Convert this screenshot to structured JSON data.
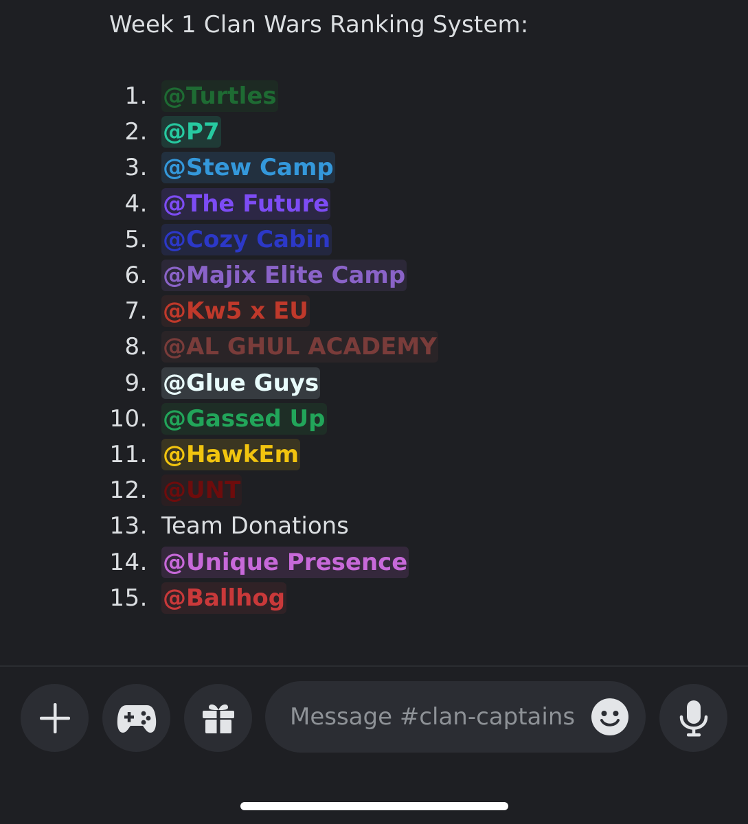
{
  "message": {
    "title": "Week 1 Clan Wars Ranking System:",
    "rankings": [
      {
        "num": "1.",
        "label": "@Turtles",
        "color": "#1e6b33",
        "bg": "#1d2a23",
        "mention": true
      },
      {
        "num": "2.",
        "label": "@P7",
        "color": "#27c9a0",
        "bg": "#1f3a36",
        "mention": true
      },
      {
        "num": "3.",
        "label": "@Stew Camp",
        "color": "#3498db",
        "bg": "#22303f",
        "mention": true
      },
      {
        "num": "4.",
        "label": "@The Future",
        "color": "#7d4cf4",
        "bg": "#2c2745",
        "mention": true
      },
      {
        "num": "5.",
        "label": "@Cozy Cabin",
        "color": "#2c38c8",
        "bg": "#232740",
        "mention": true
      },
      {
        "num": "6.",
        "label": "@Majix Elite Camp",
        "color": "#8a63c8",
        "bg": "#2c2838",
        "mention": true
      },
      {
        "num": "7.",
        "label": "@Kw5 x EU",
        "color": "#c0392b",
        "bg": "#2e2325",
        "mention": true
      },
      {
        "num": "8.",
        "label": "@AL GHUL ACADEMY",
        "color": "#7a3c3a",
        "bg": "#2a2427",
        "mention": true
      },
      {
        "num": "9.",
        "label": "@Glue Guys",
        "color": "#e8fbfb",
        "bg": "#363b40",
        "mention": true
      },
      {
        "num": "10.",
        "label": "@Gassed Up",
        "color": "#22a55a",
        "bg": "#1e2e26",
        "mention": true
      },
      {
        "num": "11.",
        "label": "@HawkEm",
        "color": "#f1c40f",
        "bg": "#3a3521",
        "mention": true
      },
      {
        "num": "12.",
        "label": "@UNT",
        "color": "#6e0c0c",
        "bg": "#2a1e21",
        "mention": true
      },
      {
        "num": "13.",
        "label": "Team Donations",
        "color": "#dbdee1",
        "bg": "transparent",
        "mention": false
      },
      {
        "num": "14.",
        "label": "@Unique Presence",
        "color": "#c769d9",
        "bg": "#35283c",
        "mention": true
      },
      {
        "num": "15.",
        "label": "@Ballhog",
        "color": "#c9393a",
        "bg": "#302226",
        "mention": true
      }
    ]
  },
  "composer": {
    "add_icon": "plus-icon",
    "games_icon": "gamepad-icon",
    "gift_icon": "gift-icon",
    "placeholder": "Message #clan-captains",
    "emoji_icon": "smile-icon",
    "mic_icon": "microphone-icon"
  }
}
